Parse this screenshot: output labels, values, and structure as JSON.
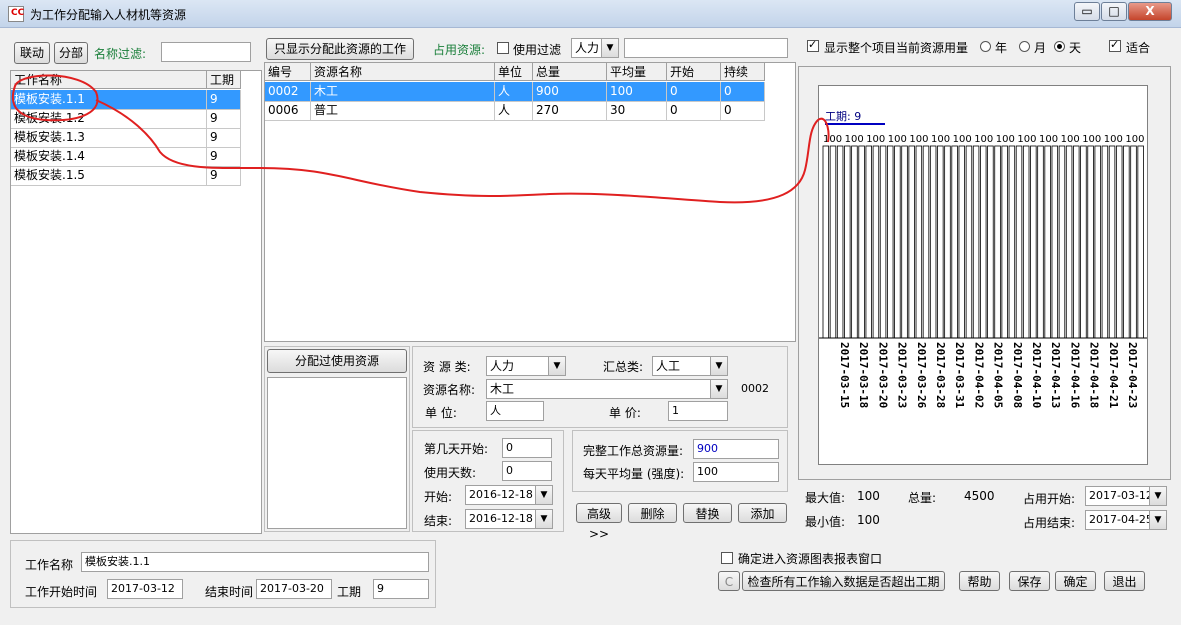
{
  "window": {
    "title": "为工作分配输入人材机等资源",
    "icon_text": "CC",
    "min_label": "▭",
    "max_label": "□",
    "close_label": "X"
  },
  "left": {
    "link_label": "联动",
    "split_label": "分部",
    "filter_label": "名称过滤:",
    "filter_value": "",
    "columns": [
      "工作名称",
      "工期"
    ],
    "rows": [
      {
        "name": "模板安装.1.1",
        "duration": "9",
        "selected": true
      },
      {
        "name": "模板安装.1.2",
        "duration": "9"
      },
      {
        "name": "模板安装.1.3",
        "duration": "9"
      },
      {
        "name": "模板安装.1.4",
        "duration": "9"
      },
      {
        "name": "模板安装.1.5",
        "duration": "9"
      }
    ]
  },
  "middle": {
    "only_assigned_label": "只显示分配此资源的工作",
    "occupy_label": "占用资源:",
    "use_filter_label": "使用过滤",
    "resource_type_value": "人力",
    "filter_value": "",
    "columns": [
      "编号",
      "资源名称",
      "单位",
      "总量",
      "平均量",
      "开始",
      "持续"
    ],
    "rows": [
      {
        "id": "0002",
        "name": "木工",
        "unit": "人",
        "total": "900",
        "avg": "100",
        "start": "0",
        "dur": "0",
        "selected": true
      },
      {
        "id": "0006",
        "name": "普工",
        "unit": "人",
        "total": "270",
        "avg": "30",
        "start": "0",
        "dur": "0"
      }
    ],
    "assigned_label": "分配过使用资源"
  },
  "detail": {
    "res_type_label": "资 源 类:",
    "res_type_value": "人力",
    "summary_label": "汇总类:",
    "summary_value": "人工",
    "res_name_label": "资源名称:",
    "res_name_value": "木工",
    "res_code": "0002",
    "unit_label": "单 位:",
    "unit_value": "人",
    "price_label": "单 价:",
    "price_value": "1",
    "start_day_label": "第几天开始:",
    "start_day_value": "0",
    "use_days_label": "使用天数:",
    "use_days_value": "0",
    "start_label": "开始:",
    "start_value": "2016-12-18",
    "end_label": "结束:",
    "end_value": "2016-12-18",
    "total_res_label": "完整工作总资源量:",
    "total_res_value": "900",
    "daily_avg_label": "每天平均量 (强度):",
    "daily_avg_value": "100",
    "advanced_label": "高级>>",
    "delete_label": "删除",
    "replace_label": "替换",
    "add_label": "添加"
  },
  "chart_panel": {
    "show_all_label": "显示整个项目当前资源用量",
    "year_label": "年",
    "month_label": "月",
    "day_label": "天",
    "fit_label": "适合",
    "max_label": "最大值:",
    "max_value": "100",
    "total_label": "总量:",
    "total_value": "4500",
    "min_label": "最小值:",
    "min_value": "100",
    "occupy_start_label": "占用开始:",
    "occupy_start_value": "2017-03-12",
    "occupy_end_label": "占用结束:",
    "occupy_end_value": "2017-04-25"
  },
  "chart_data": {
    "type": "bar",
    "title": "工期: 9",
    "value": 100,
    "bar_count": 45,
    "tick_labels": [
      "2017-03-15",
      "2017-03-18",
      "2017-03-20",
      "2017-03-23",
      "2017-03-26",
      "2017-03-28",
      "2017-03-31",
      "2017-04-02",
      "2017-04-05",
      "2017-04-08",
      "2017-04-10",
      "2017-04-13",
      "2017-04-16",
      "2017-04-18",
      "2017-04-21",
      "2017-04-23"
    ],
    "value_labels_count": 15
  },
  "bottom": {
    "work_name_label": "工作名称",
    "work_name_value": "模板安装.1.1",
    "start_time_label": "工作开始时间",
    "start_time_value": "2017-03-12",
    "end_time_label": "结束时间",
    "end_time_value": "2017-03-20",
    "duration_label": "工期",
    "duration_value": "9",
    "enter_chart_label": "确定进入资源图表报表窗口",
    "c_label": "C",
    "check_label": "检查所有工作输入数据是否超出工期",
    "help_label": "帮助",
    "save_label": "保存",
    "ok_label": "确定",
    "exit_label": "退出"
  }
}
